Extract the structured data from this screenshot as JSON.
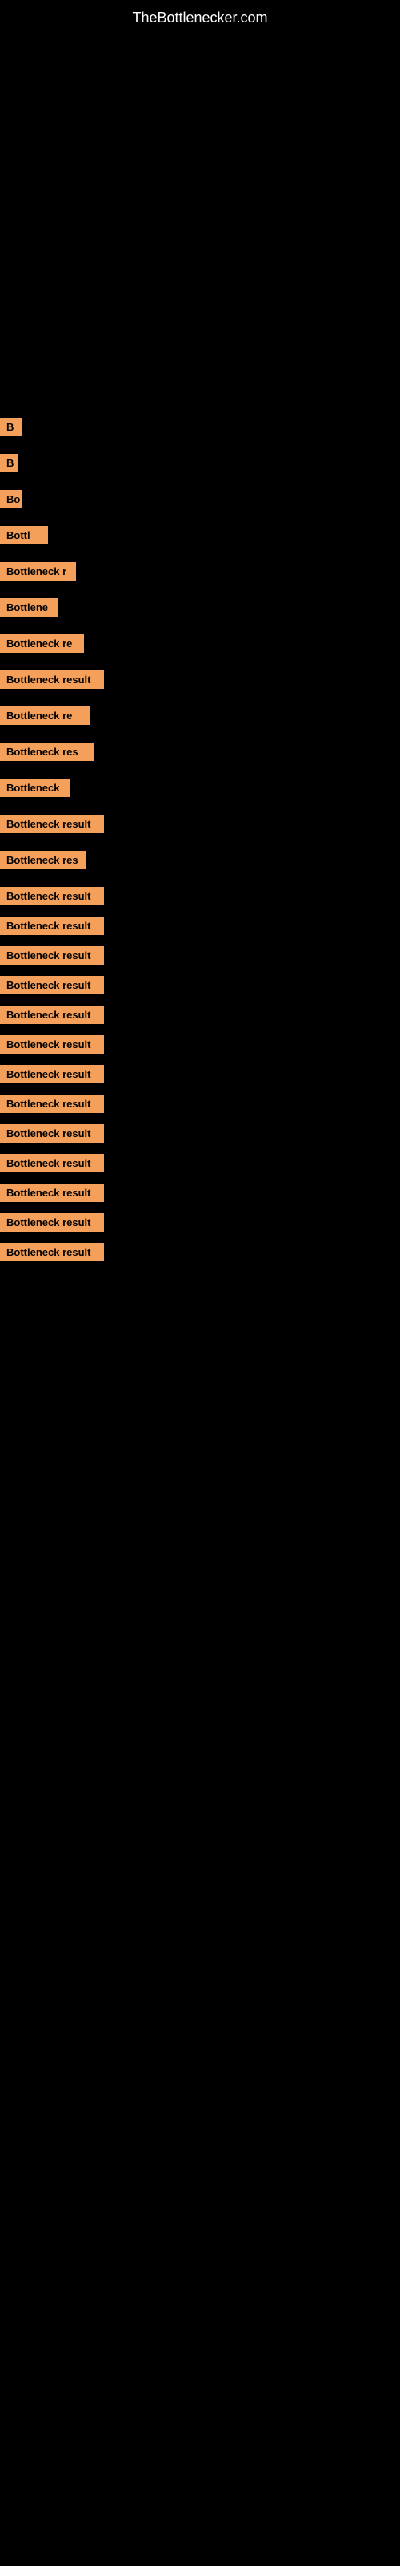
{
  "site": {
    "title": "TheBottlenecker.com"
  },
  "items": [
    {
      "id": 1,
      "label": "B",
      "widthClass": "item-w1",
      "gapClass": "row-gap-large"
    },
    {
      "id": 2,
      "label": "B",
      "widthClass": "item-w2",
      "gapClass": "row-gap-large"
    },
    {
      "id": 3,
      "label": "Bo",
      "widthClass": "item-w3",
      "gapClass": "row-gap-large"
    },
    {
      "id": 4,
      "label": "Bottl",
      "widthClass": "item-w4",
      "gapClass": "row-gap-large"
    },
    {
      "id": 5,
      "label": "Bottleneck r",
      "widthClass": "item-w5",
      "gapClass": "row-gap-large"
    },
    {
      "id": 6,
      "label": "Bottlene",
      "widthClass": "item-w6",
      "gapClass": "row-gap-large"
    },
    {
      "id": 7,
      "label": "Bottleneck re",
      "widthClass": "item-w7",
      "gapClass": "row-gap-large"
    },
    {
      "id": 8,
      "label": "Bottleneck result",
      "widthClass": "item-w8",
      "gapClass": "row-gap-large"
    },
    {
      "id": 9,
      "label": "Bottleneck re",
      "widthClass": "item-w9",
      "gapClass": "row-gap-large"
    },
    {
      "id": 10,
      "label": "Bottleneck res",
      "widthClass": "item-w10",
      "gapClass": "row-gap-large"
    },
    {
      "id": 11,
      "label": "Bottleneck",
      "widthClass": "item-w11",
      "gapClass": "row-gap-large"
    },
    {
      "id": 12,
      "label": "Bottleneck result",
      "widthClass": "item-w12",
      "gapClass": "row-gap-large"
    },
    {
      "id": 13,
      "label": "Bottleneck res",
      "widthClass": "item-w13",
      "gapClass": "row-gap-large"
    },
    {
      "id": 14,
      "label": "Bottleneck result",
      "widthClass": "item-w14",
      "gapClass": "row-gap-med"
    },
    {
      "id": 15,
      "label": "Bottleneck result",
      "widthClass": "item-w15",
      "gapClass": "row-gap-med"
    },
    {
      "id": 16,
      "label": "Bottleneck result",
      "widthClass": "item-w16",
      "gapClass": "row-gap-med"
    },
    {
      "id": 17,
      "label": "Bottleneck result",
      "widthClass": "item-w17",
      "gapClass": "row-gap-med"
    },
    {
      "id": 18,
      "label": "Bottleneck result",
      "widthClass": "item-w18",
      "gapClass": "row-gap-med"
    },
    {
      "id": 19,
      "label": "Bottleneck result",
      "widthClass": "item-w19",
      "gapClass": "row-gap-med"
    },
    {
      "id": 20,
      "label": "Bottleneck result",
      "widthClass": "item-w20",
      "gapClass": "row-gap-med"
    },
    {
      "id": 21,
      "label": "Bottleneck result",
      "widthClass": "item-w21",
      "gapClass": "row-gap-med"
    },
    {
      "id": 22,
      "label": "Bottleneck result",
      "widthClass": "item-w22",
      "gapClass": "row-gap-med"
    },
    {
      "id": 23,
      "label": "Bottleneck result",
      "widthClass": "item-w23",
      "gapClass": "row-gap-med"
    },
    {
      "id": 24,
      "label": "Bottleneck result",
      "widthClass": "item-w24",
      "gapClass": "row-gap-med"
    },
    {
      "id": 25,
      "label": "Bottleneck result",
      "widthClass": "item-w25",
      "gapClass": "row-gap-med"
    },
    {
      "id": 26,
      "label": "Bottleneck result",
      "widthClass": "item-w26",
      "gapClass": "row-gap-med"
    }
  ]
}
